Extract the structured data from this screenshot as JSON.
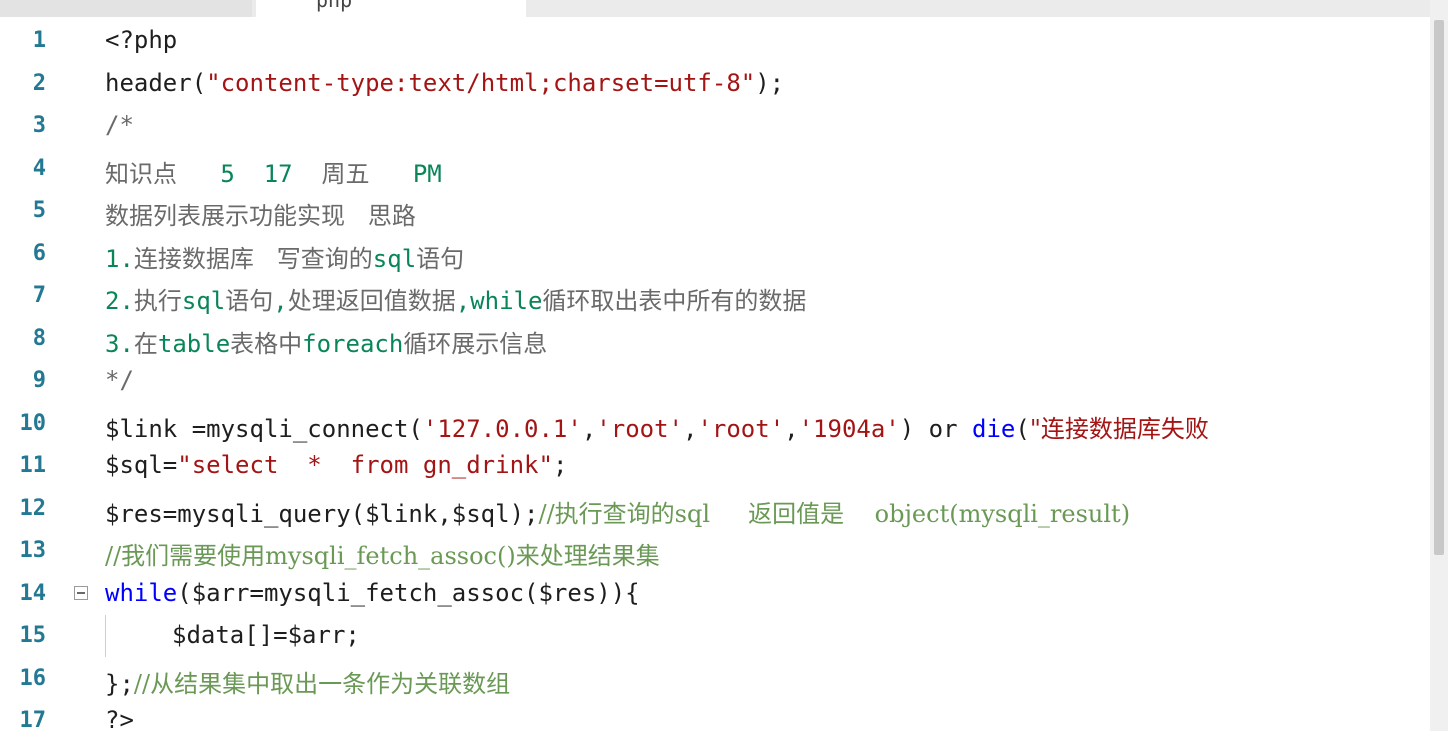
{
  "tab": {
    "label": "php"
  },
  "lines": [
    {
      "n": "1",
      "parts": [
        {
          "t": "<?php",
          "c": "c-plain"
        }
      ]
    },
    {
      "n": "2",
      "parts": [
        {
          "t": "header(",
          "c": "c-plain"
        },
        {
          "t": "\"content-type:text/html;charset=utf-8\"",
          "c": "c-str"
        },
        {
          "t": ");",
          "c": "c-plain"
        }
      ]
    },
    {
      "n": "3",
      "parts": [
        {
          "t": "/*",
          "c": "c-comment-block"
        }
      ]
    },
    {
      "n": "4",
      "parts": [
        {
          "t": "知识点",
          "c": "c-comment-block c-cjk"
        },
        {
          "t": "   5  17  ",
          "c": "c-num"
        },
        {
          "t": "周五",
          "c": "c-comment-block c-cjk"
        },
        {
          "t": "   PM",
          "c": "c-num"
        }
      ]
    },
    {
      "n": "5",
      "parts": [
        {
          "t": "数据列表展示功能实现   思路",
          "c": "c-comment-block c-cjk"
        }
      ]
    },
    {
      "n": "6",
      "parts": [
        {
          "t": "1.",
          "c": "c-num"
        },
        {
          "t": "连接数据库   写查询的",
          "c": "c-comment-block c-cjk"
        },
        {
          "t": "sql",
          "c": "c-num"
        },
        {
          "t": "语句",
          "c": "c-comment-block c-cjk"
        }
      ]
    },
    {
      "n": "7",
      "parts": [
        {
          "t": "2.",
          "c": "c-num"
        },
        {
          "t": "执行",
          "c": "c-comment-block c-cjk"
        },
        {
          "t": "sql",
          "c": "c-num"
        },
        {
          "t": "语句",
          "c": "c-comment-block c-cjk"
        },
        {
          "t": ",",
          "c": "c-num"
        },
        {
          "t": "处理返回值数据",
          "c": "c-comment-block c-cjk"
        },
        {
          "t": ",while",
          "c": "c-num"
        },
        {
          "t": "循环取出表中所有的数据",
          "c": "c-comment-block c-cjk"
        }
      ]
    },
    {
      "n": "8",
      "parts": [
        {
          "t": "3.",
          "c": "c-num"
        },
        {
          "t": "在",
          "c": "c-comment-block c-cjk"
        },
        {
          "t": "table",
          "c": "c-num"
        },
        {
          "t": "表格中",
          "c": "c-comment-block c-cjk"
        },
        {
          "t": "foreach",
          "c": "c-num"
        },
        {
          "t": "循环展示信息",
          "c": "c-comment-block c-cjk"
        }
      ]
    },
    {
      "n": "9",
      "parts": [
        {
          "t": "*/",
          "c": "c-comment-block"
        }
      ]
    },
    {
      "n": "10",
      "parts": [
        {
          "t": "$link =mysqli_connect(",
          "c": "c-plain"
        },
        {
          "t": "'127.0.0.1'",
          "c": "c-str"
        },
        {
          "t": ",",
          "c": "c-plain"
        },
        {
          "t": "'root'",
          "c": "c-str"
        },
        {
          "t": ",",
          "c": "c-plain"
        },
        {
          "t": "'root'",
          "c": "c-str"
        },
        {
          "t": ",",
          "c": "c-plain"
        },
        {
          "t": "'1904a'",
          "c": "c-str"
        },
        {
          "t": ") or ",
          "c": "c-plain"
        },
        {
          "t": "die",
          "c": "c-kw"
        },
        {
          "t": "(",
          "c": "c-plain"
        },
        {
          "t": "\"连接数据库失败",
          "c": "c-str c-cjk"
        }
      ]
    },
    {
      "n": "11",
      "parts": [
        {
          "t": "$sql=",
          "c": "c-plain"
        },
        {
          "t": "\"select  *  from gn_drink\"",
          "c": "c-str"
        },
        {
          "t": ";",
          "c": "c-plain"
        }
      ]
    },
    {
      "n": "12",
      "parts": [
        {
          "t": "$res=mysqli_query($link,$sql);",
          "c": "c-plain"
        },
        {
          "t": "//执行查询的sql     返回值是    object(mysqli_result)",
          "c": "c-com c-cjk"
        }
      ]
    },
    {
      "n": "13",
      "parts": [
        {
          "t": "//我们需要使用mysqli_fetch_assoc()来处理结果集",
          "c": "c-com c-cjk"
        }
      ]
    },
    {
      "n": "14",
      "fold": true,
      "parts": [
        {
          "t": "while",
          "c": "c-kw"
        },
        {
          "t": "($arr=mysqli_fetch_assoc($res)){",
          "c": "c-plain"
        }
      ]
    },
    {
      "n": "15",
      "indent": true,
      "parts": [
        {
          "t": "$data[]=$arr;",
          "c": "c-plain"
        }
      ]
    },
    {
      "n": "16",
      "parts": [
        {
          "t": "};",
          "c": "c-plain"
        },
        {
          "t": "//从结果集中取出一条作为关联数组",
          "c": "c-com c-cjk"
        }
      ]
    },
    {
      "n": "17",
      "parts": [
        {
          "t": "?>",
          "c": "c-plain"
        }
      ]
    }
  ]
}
